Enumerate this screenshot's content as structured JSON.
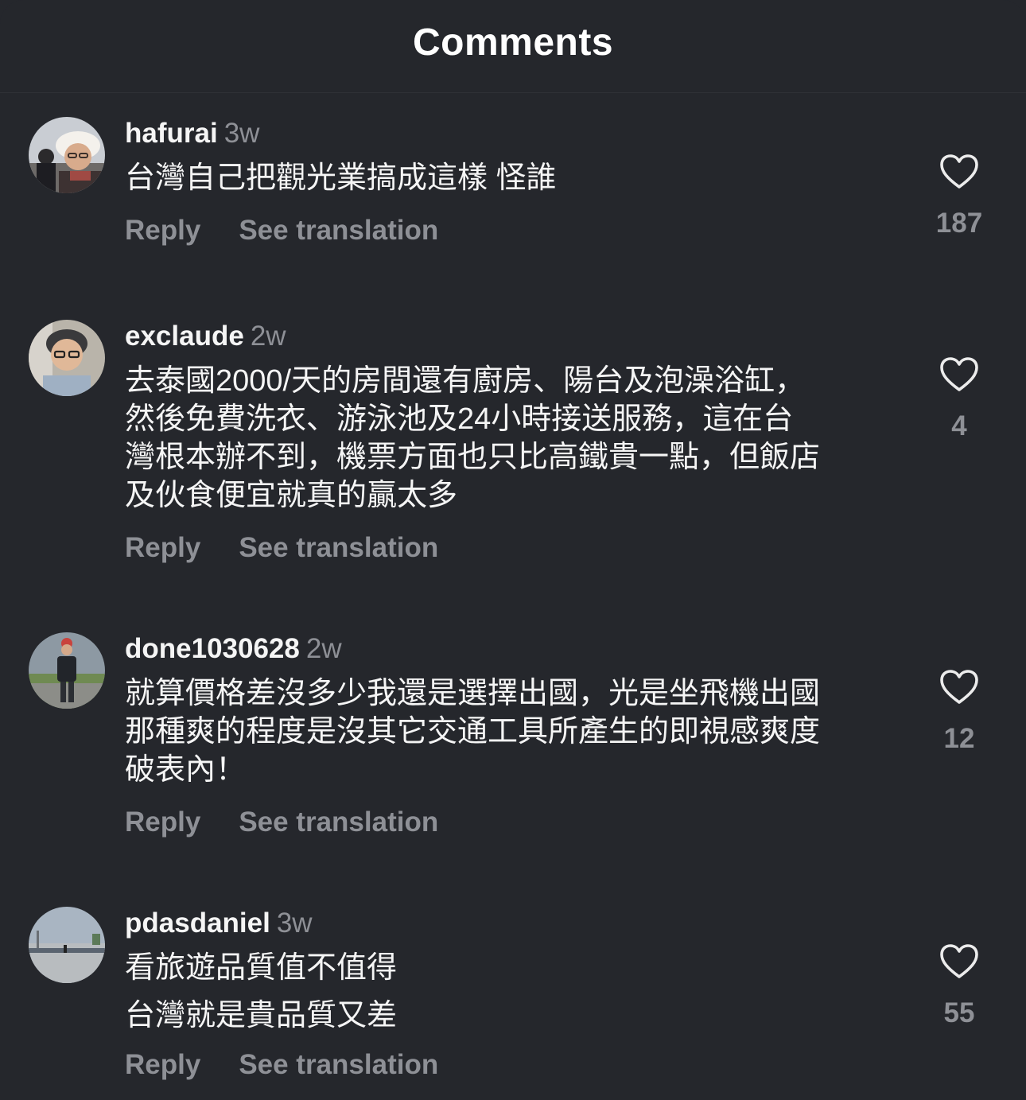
{
  "header": {
    "title": "Comments"
  },
  "comments": [
    {
      "username": "hafurai",
      "time": "3w",
      "text": "台灣自己把觀光業搞成這樣 怪誰",
      "reply_label": "Reply",
      "translate_label": "See translation",
      "likes": "187"
    },
    {
      "username": "exclaude",
      "time": "2w",
      "text": "去泰國2000/天的房間還有廚房、陽台及泡澡浴缸，\n然後免費洗衣、游泳池及24小時接送服務，這在台\n灣根本辦不到，機票方面也只比高鐵貴一點，但飯店\n及伙食便宜就真的贏太多",
      "reply_label": "Reply",
      "translate_label": "See translation",
      "likes": "4"
    },
    {
      "username": "done1030628",
      "time": "2w",
      "text": "就算價格差沒多少我還是選擇出國，光是坐飛機出國\n那種爽的程度是沒其它交通工具所產生的即視感爽度\n破表內！",
      "reply_label": "Reply",
      "translate_label": "See translation",
      "likes": "12"
    },
    {
      "username": "pdasdaniel",
      "time": "3w",
      "text": "看旅遊品質值不值得\n台灣就是貴品質又差",
      "reply_label": "Reply",
      "translate_label": "See translation",
      "likes": "55"
    }
  ],
  "colors": {
    "background": "#25272c",
    "primary_text": "#f5f5f5",
    "secondary_text": "#8e9096"
  },
  "icons": {
    "like": "heart-outline-icon"
  }
}
